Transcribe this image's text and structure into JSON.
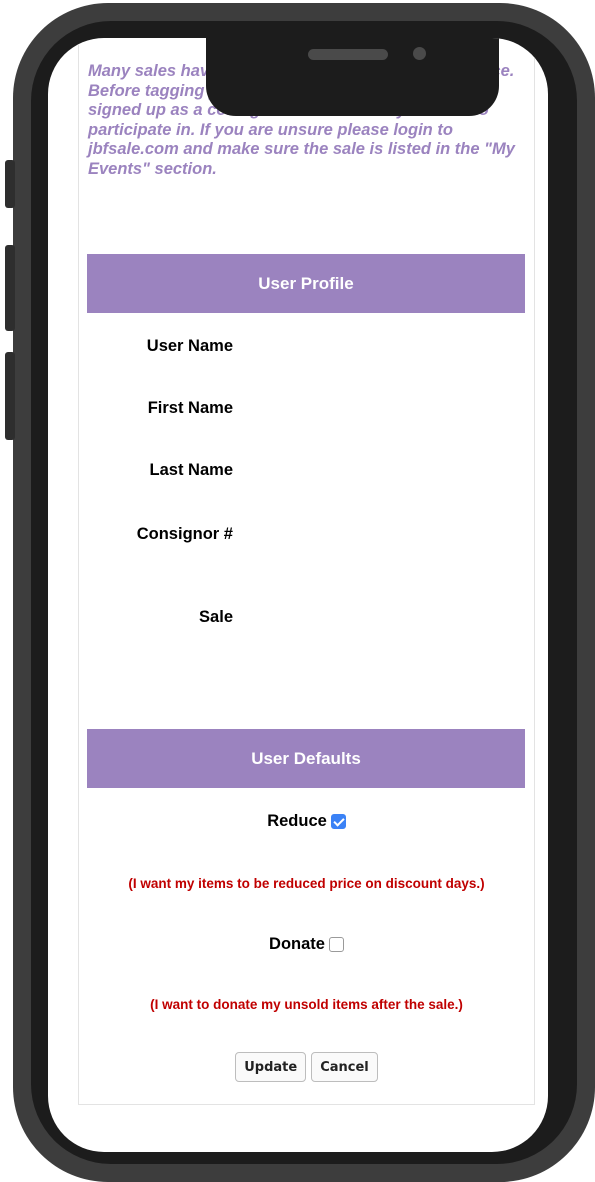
{
  "notice": "Many sales have a limited amount of consignor space. Before tagging your items, make sure that you have signed up as a consignor for each sale you want to participate in. If you are unsure please login to jbfsale.com and make sure the sale is listed in the \"My Events\" section.",
  "profile": {
    "header": "User Profile",
    "fields": {
      "user_name": "User Name",
      "first_name": "First Name",
      "last_name": "Last Name",
      "consignor": "Consignor #",
      "sale": "Sale"
    }
  },
  "defaults": {
    "header": "User Defaults",
    "reduce": {
      "label": "Reduce",
      "checked": true,
      "note": "(I want my items to be reduced price on discount days.)"
    },
    "donate": {
      "label": "Donate",
      "checked": false,
      "note": "(I want to donate my unsold items after the sale.)"
    }
  },
  "actions": {
    "update": "Update",
    "cancel": "Cancel"
  },
  "colors": {
    "accent": "#9b83bf",
    "note": "#c00000",
    "checkbox": "#3b82f6"
  }
}
